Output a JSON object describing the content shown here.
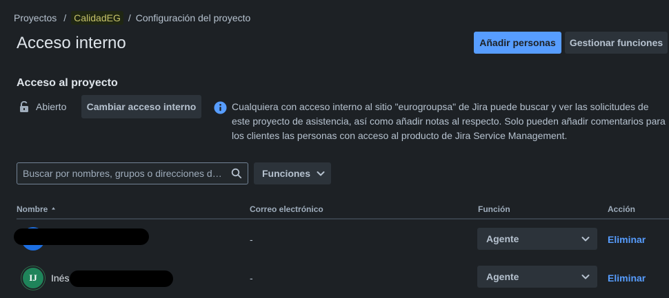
{
  "breadcrumb": {
    "items": [
      "Proyectos",
      "CalidadEG",
      "Configuración del proyecto"
    ],
    "separator": "/"
  },
  "page": {
    "title": "Acceso interno"
  },
  "header_actions": {
    "add_people": "Añadir personas",
    "manage_roles": "Gestionar funciones"
  },
  "project_access": {
    "title": "Acceso al proyecto",
    "status": "Abierto",
    "change_button": "Cambiar acceso interno",
    "info": "Cualquiera con acceso interno al sitio \"eurogroupsa\" de Jira puede buscar y ver las solicitudes de este proyecto de asistencia, así como añadir notas al respecto. Solo pueden añadir comentarios para los clientes las personas con acceso al producto de Jira Service Management."
  },
  "filters": {
    "search_placeholder": "Buscar por nombres, grupos o direcciones de correo electrónico",
    "roles_button": "Funciones"
  },
  "table": {
    "columns": {
      "name": "Nombre",
      "email": "Correo electrónico",
      "role": "Función",
      "action": "Acción"
    },
    "rows": [
      {
        "initials": "",
        "name": "",
        "email": "-",
        "role": "Agente",
        "action": "Eliminar"
      },
      {
        "initials": "IJ",
        "name": "Inés",
        "email": "-",
        "role": "Agente",
        "action": "Eliminar"
      }
    ]
  },
  "colors": {
    "background": "#1d2125",
    "primary": "#579dff",
    "link": "#579dff",
    "avatar_green": "#1f845a",
    "avatar_blue": "#1d6fe2"
  }
}
